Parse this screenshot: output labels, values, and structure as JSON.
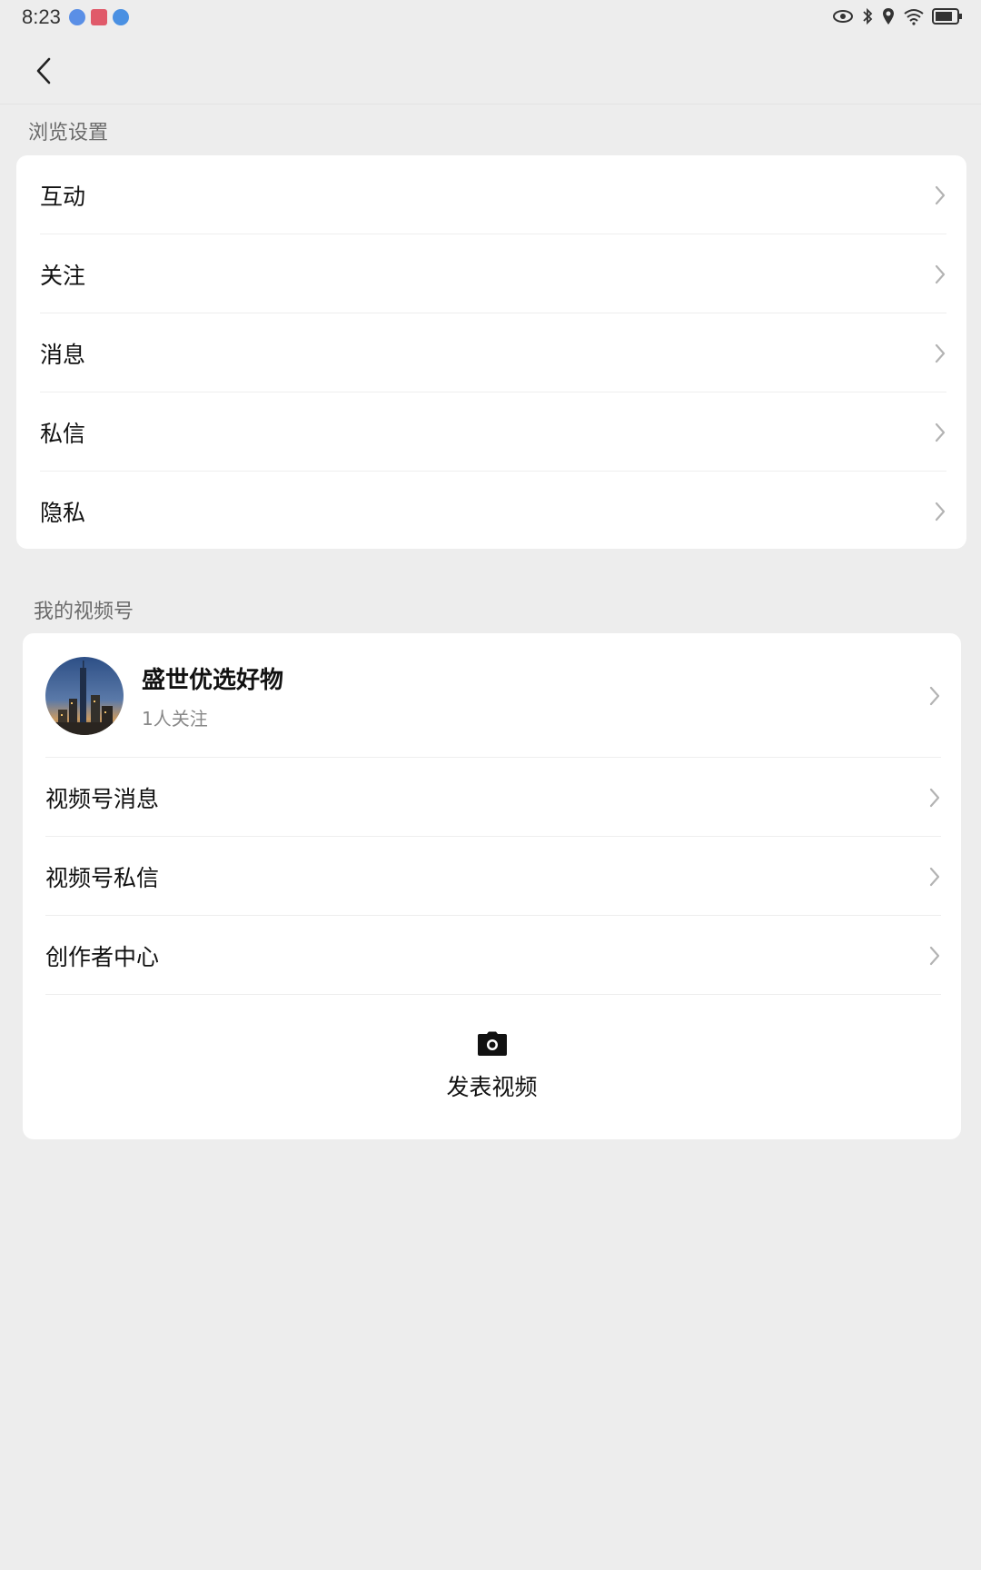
{
  "status_bar": {
    "time": "8:23",
    "app_icons": [
      "music-app-icon",
      "mail-app-icon",
      "browser-app-icon"
    ],
    "system_icons": [
      "eye-icon",
      "bluetooth-icon",
      "location-icon",
      "wifi-icon",
      "battery-icon"
    ]
  },
  "nav": {
    "back_icon": "chevron-left-icon"
  },
  "browse_settings": {
    "title": "浏览设置",
    "items": [
      {
        "label": "互动"
      },
      {
        "label": "关注"
      },
      {
        "label": "消息"
      },
      {
        "label": "私信"
      },
      {
        "label": "隐私"
      }
    ]
  },
  "channels": {
    "title": "我的视频号",
    "profile": {
      "name": "盛世优选好物",
      "followers": "1人关注"
    },
    "items": [
      {
        "label": "视频号消息"
      },
      {
        "label": "视频号私信"
      },
      {
        "label": "创作者中心"
      }
    ],
    "publish_label": "发表视频"
  },
  "colors": {
    "background": "#ededed",
    "card": "#ffffff",
    "text": "#111111",
    "muted": "#888888"
  }
}
